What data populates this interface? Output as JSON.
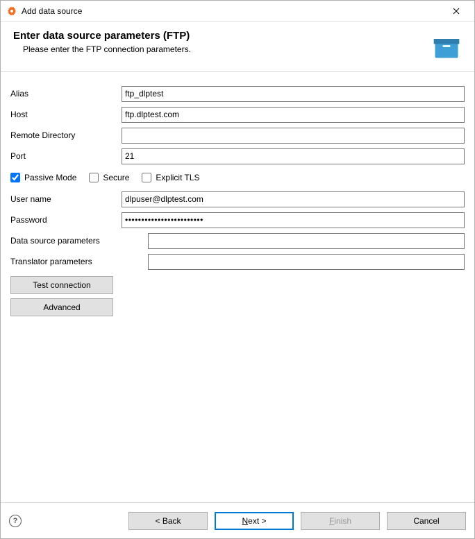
{
  "window": {
    "title": "Add data source"
  },
  "banner": {
    "heading": "Enter data source parameters (FTP)",
    "subheading": "Please enter the FTP connection parameters."
  },
  "form": {
    "alias": {
      "label": "Alias",
      "value": "ftp_dlptest"
    },
    "host": {
      "label": "Host",
      "value": "ftp.dlptest.com"
    },
    "remote": {
      "label": "Remote Directory",
      "value": ""
    },
    "port": {
      "label": "Port",
      "value": "21"
    },
    "passive": {
      "label": "Passive Mode",
      "checked": true
    },
    "secure": {
      "label": "Secure",
      "checked": false
    },
    "explicit": {
      "label": "Explicit TLS",
      "checked": false
    },
    "user": {
      "label": "User name",
      "value": "dlpuser@dlptest.com"
    },
    "password": {
      "label": "Password",
      "value": "••••••••••••••••••••••••"
    },
    "dsparams": {
      "label": "Data source parameters",
      "value": ""
    },
    "trparams": {
      "label": "Translator parameters",
      "value": ""
    }
  },
  "buttons": {
    "test": "Test connection",
    "advanced": "Advanced",
    "back": "< Back",
    "next_pre": "N",
    "next_post": "ext >",
    "finish_pre": "F",
    "finish_post": "inish",
    "cancel": "Cancel"
  }
}
